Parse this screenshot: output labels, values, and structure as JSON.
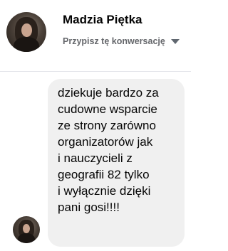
{
  "header": {
    "contact_name": "Madzia Piętka",
    "assign_label": "Przypisz tę konwersację",
    "avatar_icon": "profile-photo",
    "dropdown_icon": "caret-down-icon"
  },
  "conversation": {
    "messages": [
      {
        "text": "dziekuje bardzo za\ncudowne wsparcie\nze strony zarówno\norganizatorów jak\ni nauczycieli z\ngeografii 82 tylko\ni wyłącznie dzięki\npani gosi!!!!",
        "bubble_color": "#f0f0f0"
      }
    ]
  },
  "colors": {
    "name_text": "#050505",
    "secondary_text": "#65676b",
    "divider": "#e4e6eb"
  }
}
